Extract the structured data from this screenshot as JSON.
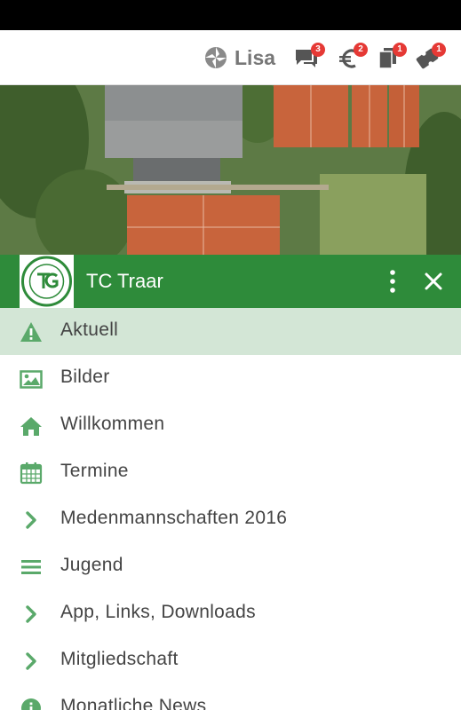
{
  "topbar": {
    "user_name": "Lisa",
    "badges": {
      "messages": "3",
      "payments": "2",
      "documents": "1",
      "tickets": "1"
    }
  },
  "drawer": {
    "logo_text": "TENNISCLUB TRAAR 1977 e.V.",
    "club_name": "TC Traar"
  },
  "menu": [
    {
      "label": "Aktuell",
      "icon": "warning-icon",
      "active": true
    },
    {
      "label": "Bilder",
      "icon": "image-icon"
    },
    {
      "label": "Willkommen",
      "icon": "home-icon"
    },
    {
      "label": "Termine",
      "icon": "calendar-icon"
    },
    {
      "label": "Medenmannschaften 2016",
      "icon": "chevron-right-icon"
    },
    {
      "label": "Jugend",
      "icon": "list-icon"
    },
    {
      "label": "App, Links, Downloads",
      "icon": "chevron-right-icon"
    },
    {
      "label": "Mitgliedschaft",
      "icon": "chevron-right-icon"
    },
    {
      "label": "Monatliche News",
      "icon": "info-icon"
    }
  ],
  "colors": {
    "accent": "#2e8b3a",
    "icon_green": "#5aa96a",
    "active_row": "#d3e6d6",
    "badge": "#e53935"
  }
}
